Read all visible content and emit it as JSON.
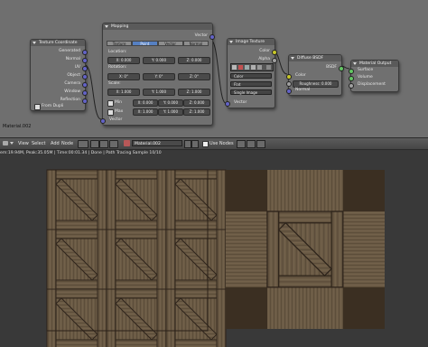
{
  "node_editor": {
    "material_label": "Material.002",
    "texcoord": {
      "title": "Texture Coordinate",
      "outputs": [
        "Generated",
        "Normal",
        "UV",
        "Object",
        "Camera",
        "Window",
        "Reflection"
      ],
      "from_dupli": "From Dupli"
    },
    "mapping": {
      "title": "Mapping",
      "vector_out": "Vector",
      "types": [
        "Texture",
        "Point",
        "Vector",
        "Normal"
      ],
      "active_type": "Point",
      "location_label": "Location:",
      "location": [
        "X: 0.000",
        "Y: 0.000",
        "Z: 0.000"
      ],
      "rotation_label": "Rotation:",
      "rotation": [
        "X: 0°",
        "Y: 0°",
        "Z: 0°"
      ],
      "scale_label": "Scale:",
      "scale": [
        "X: 1.000",
        "Y: 1.000",
        "Z: 1.000"
      ],
      "min_label": "Min",
      "min": [
        "X: 0.000",
        "Y: 0.000",
        "Z: 0.000"
      ],
      "max_label": "Max",
      "max": [
        "X: 1.000",
        "Y: 1.000",
        "Z: 1.000"
      ],
      "vector_in": "Vector"
    },
    "image_texture": {
      "title": "Image Texture",
      "outputs": [
        "Color",
        "Alpha"
      ],
      "color_mode": "Color",
      "projection": "Flat",
      "source": "Single Image",
      "vector_in": "Vector"
    },
    "diffuse": {
      "title": "Diffuse BSDF",
      "output": "BSDF",
      "color_in": "Color",
      "roughness": "Roughness: 0.000",
      "normal_in": "Normal"
    },
    "output": {
      "title": "Material Output",
      "inputs": [
        "Surface",
        "Volume",
        "Displacement"
      ]
    }
  },
  "header": {
    "menus": [
      "View",
      "Select",
      "Add",
      "Node"
    ],
    "material_field": "Material.002",
    "use_nodes": "Use Nodes"
  },
  "status": "em:19.94M, Peak:35.05M | Time:00:01.34 | Done | Path Tracing Sample 10/10",
  "colors": {
    "editor_bg": "#6f6f6f",
    "node_bg": "#707070",
    "socket_vector": "#6363c7",
    "socket_color": "#c7c729",
    "socket_shader": "#63c763",
    "viewport_bg": "#393939",
    "wood_dark": "#3d2f23",
    "wood_light": "#6b5a44"
  }
}
